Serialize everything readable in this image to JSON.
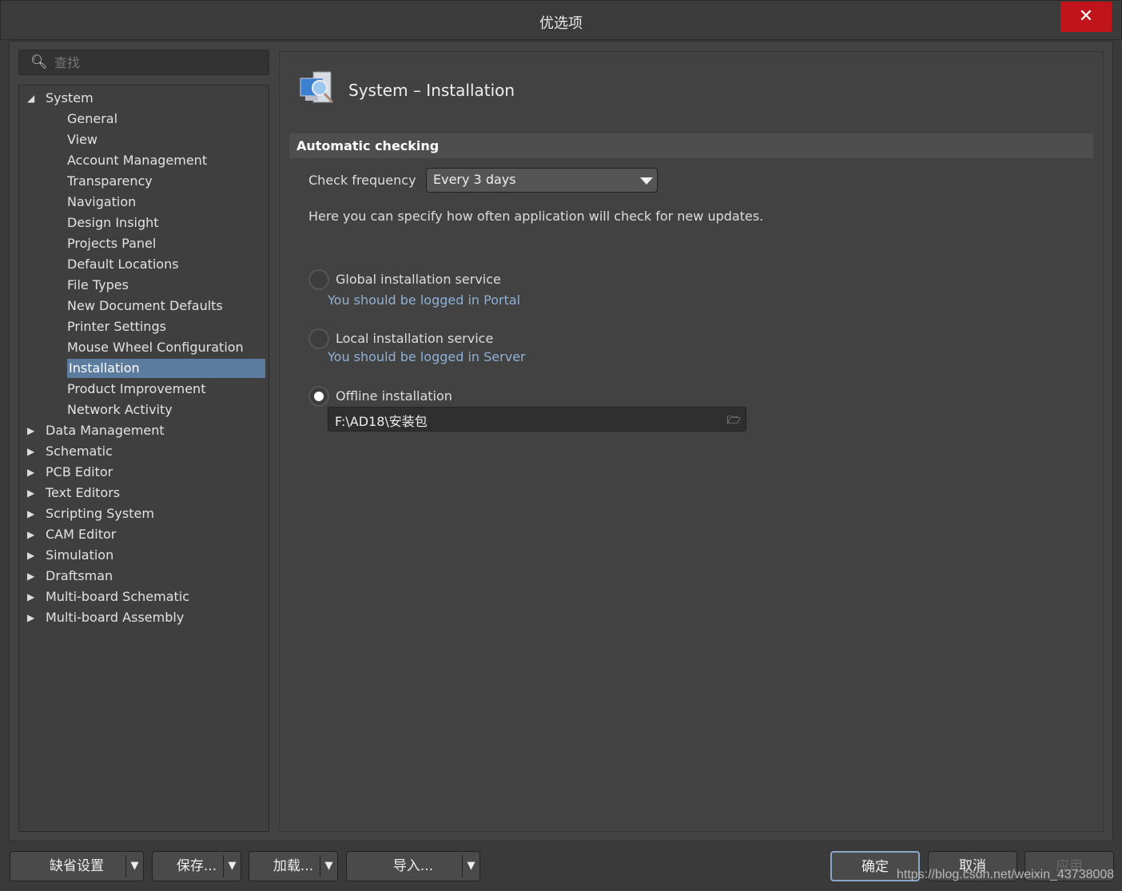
{
  "window": {
    "title": "优选项",
    "close_icon": "close-icon"
  },
  "search": {
    "placeholder": "查找"
  },
  "tree": [
    {
      "label": "System",
      "level": 0,
      "expanded": true
    },
    {
      "label": "General",
      "level": 1
    },
    {
      "label": "View",
      "level": 1
    },
    {
      "label": "Account Management",
      "level": 1
    },
    {
      "label": "Transparency",
      "level": 1
    },
    {
      "label": "Navigation",
      "level": 1
    },
    {
      "label": "Design Insight",
      "level": 1
    },
    {
      "label": "Projects Panel",
      "level": 1
    },
    {
      "label": "Default Locations",
      "level": 1
    },
    {
      "label": "File Types",
      "level": 1
    },
    {
      "label": "New Document Defaults",
      "level": 1
    },
    {
      "label": "Printer Settings",
      "level": 1
    },
    {
      "label": "Mouse Wheel Configuration",
      "level": 1
    },
    {
      "label": "Installation",
      "level": 1,
      "selected": true
    },
    {
      "label": "Product Improvement",
      "level": 1
    },
    {
      "label": "Network Activity",
      "level": 1
    },
    {
      "label": "Data Management",
      "level": 0
    },
    {
      "label": "Schematic",
      "level": 0
    },
    {
      "label": "PCB Editor",
      "level": 0
    },
    {
      "label": "Text Editors",
      "level": 0
    },
    {
      "label": "Scripting System",
      "level": 0
    },
    {
      "label": "CAM Editor",
      "level": 0
    },
    {
      "label": "Simulation",
      "level": 0
    },
    {
      "label": "Draftsman",
      "level": 0
    },
    {
      "label": "Multi-board Schematic",
      "level": 0
    },
    {
      "label": "Multi-board Assembly",
      "level": 0
    }
  ],
  "main": {
    "title": "System – Installation",
    "section": "Automatic checking",
    "check_frequency_label": "Check frequency",
    "check_frequency_value": "Every 3 days",
    "description": "Here you can specify how often application will check for new updates.",
    "options": [
      {
        "label": "Global installation service",
        "hint": "You should be logged in Portal",
        "selected": false
      },
      {
        "label": "Local installation service",
        "hint": "You should be logged in Server",
        "selected": false
      },
      {
        "label": "Offline installation",
        "selected": true
      }
    ],
    "offline_path": "F:\\AD18\\安装包"
  },
  "footer": {
    "defaults": "缺省设置",
    "save": "保存...",
    "load": "加载...",
    "import": "导入...",
    "ok": "确定",
    "cancel": "取消",
    "apply": "应用"
  },
  "watermark": "https://blog.csdn.net/weixin_43738008"
}
